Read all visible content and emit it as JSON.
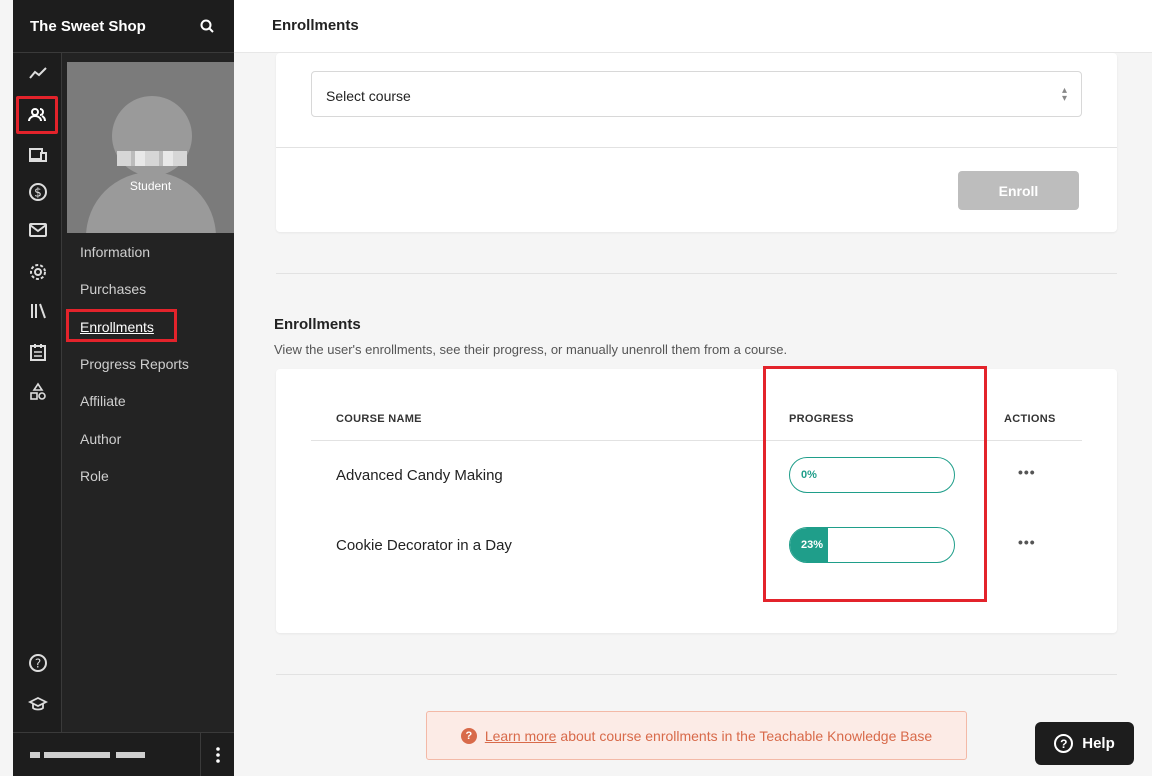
{
  "app": {
    "brand": "The Sweet Shop"
  },
  "header": {
    "title": "Enrollments"
  },
  "sidebar": {
    "icons": [
      "analytics-icon",
      "users-icon",
      "devices-icon",
      "dollar-icon",
      "mail-icon",
      "settings-icon",
      "library-icon",
      "calendar-icon",
      "shapes-icon",
      "help-circle-icon",
      "graduation-icon"
    ],
    "active_icon": "users-icon"
  },
  "profile": {
    "role": "Student"
  },
  "subnav": {
    "items": [
      "Information",
      "Purchases",
      "Enrollments",
      "Progress Reports",
      "Affiliate",
      "Author",
      "Role"
    ],
    "active": "Enrollments"
  },
  "enroll_form": {
    "select_placeholder": "Select course",
    "enroll_label": "Enroll"
  },
  "enrollments": {
    "title": "Enrollments",
    "description": "View the user's enrollments, see their progress, or manually unenroll them from a course.",
    "columns": {
      "course": "COURSE NAME",
      "progress": "PROGRESS",
      "actions": "ACTIONS"
    },
    "rows": [
      {
        "course": "Advanced Candy Making",
        "progress_label": "0%",
        "progress": 0
      },
      {
        "course": "Cookie Decorator in a Day",
        "progress_label": "23%",
        "progress": 23
      }
    ],
    "actions_glyph": "•••"
  },
  "knowledge_base": {
    "link": "Learn more",
    "text": "about course enrollments in the Teachable Knowledge Base"
  },
  "help": {
    "label": "Help"
  },
  "colors": {
    "accent": "#1f9e8a",
    "highlight": "#e3232b",
    "sidebar": "#1d1d1d"
  }
}
